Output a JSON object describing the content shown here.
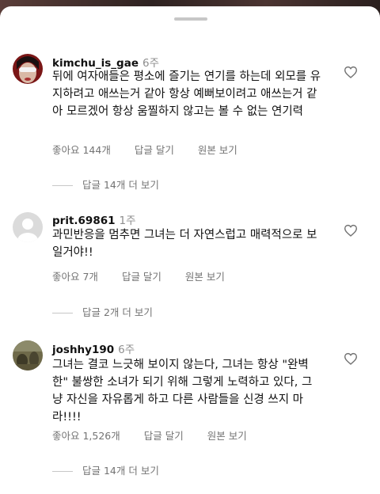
{
  "comments": [
    {
      "username": "kimchu_is_gae",
      "age": "6주",
      "text": "뒤에 여자애들은 평소에 즐기는 연기를 하는데 외모를 유지하려고 애쓰는거 같아 항상 예뻐보이려고 애쓰는거 같아 모르겠어 항상 움찔하지 않고는 볼 수 없는 연기력",
      "likes": "좋아요 144개",
      "reply": "답글 달기",
      "see_original": "원본 보기",
      "view_replies": "답글 14개 더 보기"
    },
    {
      "username": "prit.69861",
      "age": "1주",
      "text": "과민반응을 멈추면 그녀는 더 자연스럽고 매력적으로 보일거야!!",
      "likes": "좋아요 7개",
      "reply": "답글 달기",
      "see_original": "원본 보기",
      "view_replies": "답글 2개 더 보기"
    },
    {
      "username": "joshhy190",
      "age": "6주",
      "text": "그녀는 결코 느긋해 보이지 않는다, 그녀는 항상 \"완벽한\" 불쌍한 소녀가 되기 위해 그렇게 노력하고 있다, 그냥 자신을 자유롭게 하고 다른 사람들을 신경 쓰지 마라!!!!",
      "likes": "좋아요 1,526개",
      "reply": "답글 달기",
      "see_original": "원본 보기",
      "view_replies": "답글 14개 더 보기"
    }
  ],
  "icons": {
    "like": "heart-outline-icon",
    "grabber": "drag-handle"
  },
  "colors": {
    "sheet": "#ffffff",
    "secondary_text": "#737373"
  }
}
